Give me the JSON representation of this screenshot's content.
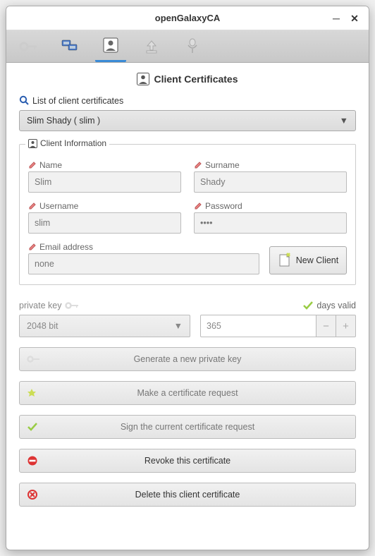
{
  "window": {
    "title": "openGalaxyCA"
  },
  "page": {
    "heading": "Client Certificates",
    "list_label": "List of client certificates"
  },
  "dropdown": {
    "selected": "Slim Shady  ( slim )"
  },
  "fieldset": {
    "legend": "Client Information"
  },
  "labels": {
    "name": "Name",
    "surname": "Surname",
    "username": "Username",
    "password": "Password",
    "email": "Email address"
  },
  "values": {
    "name": "Slim",
    "surname": "Shady",
    "username": "slim",
    "password": "••••",
    "email": "none"
  },
  "buttons": {
    "new_client": "New Client",
    "generate": "Generate a new private key",
    "make_request": "Make a certificate request",
    "sign": "Sign the current certificate request",
    "revoke": "Revoke this certificate",
    "delete": "Delete this client certificate"
  },
  "key": {
    "label": "private key",
    "size": "2048 bit"
  },
  "days": {
    "label": "days valid",
    "value": "365"
  }
}
